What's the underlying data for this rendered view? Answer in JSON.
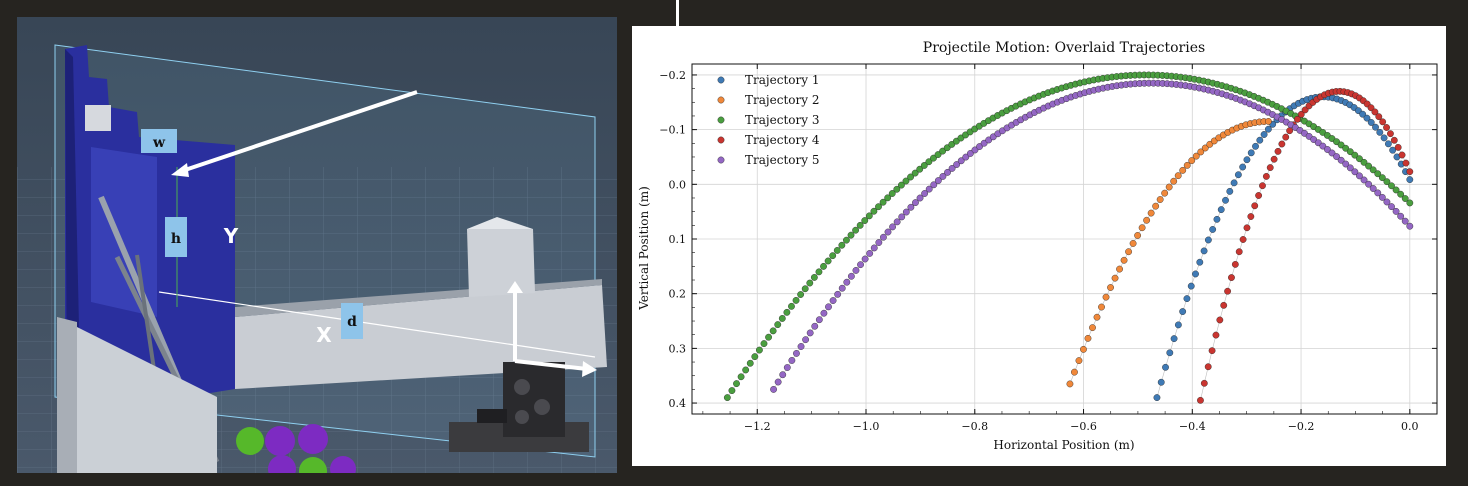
{
  "cad_view": {
    "labels": {
      "w": "w",
      "h": "h",
      "Y": "Y",
      "X": "X",
      "d": "d"
    },
    "colors": {
      "background": "#3e4c5e",
      "backboard": "#2a2f9e",
      "label_box": "#8ec4ea",
      "arrow": "#ffffff",
      "ball_green": "#56b82a",
      "ball_purple": "#7d2bc2"
    }
  },
  "chart_data": {
    "type": "scatter",
    "title": "Projectile Motion: Overlaid Trajectories",
    "xlabel": "Horizontal Position (m)",
    "ylabel": "Vertical Position (m)",
    "xlim": [
      -1.32,
      0.05
    ],
    "ylim": [
      0.42,
      -0.22
    ],
    "y_inverted": true,
    "xticks": [
      -1.2,
      -1.0,
      -0.8,
      -0.6,
      -0.4,
      -0.2,
      0.0
    ],
    "xtick_labels": [
      "−1.2",
      "−1.0",
      "−0.8",
      "−0.6",
      "−0.4",
      "−0.2",
      "0.0"
    ],
    "yticks": [
      -0.2,
      -0.1,
      0.0,
      0.1,
      0.2,
      0.3,
      0.4
    ],
    "ytick_labels": [
      "−0.2",
      "−0.1",
      "0.0",
      "0.1",
      "0.2",
      "0.3",
      "0.4"
    ],
    "grid": true,
    "legend_position": "top-left",
    "series": [
      {
        "name": "Trajectory 1",
        "color": "#3f7ab5",
        "x_start": -0.465,
        "x_end": 0.0,
        "x_peak": -0.16,
        "y_peak": -0.16,
        "y_start": 0.39,
        "y_end": 0.0,
        "n_points": 60
      },
      {
        "name": "Trajectory 2",
        "color": "#f0883a",
        "x_start": -0.625,
        "x_end": -0.26,
        "x_peak": -0.26,
        "y_peak": -0.115,
        "y_start": 0.365,
        "y_end": -0.115,
        "n_points": 45
      },
      {
        "name": "Trajectory 3",
        "color": "#4a9e3f",
        "x_start": -1.255,
        "x_end": 0.0,
        "x_peak": -0.485,
        "y_peak": -0.2,
        "y_start": 0.39,
        "y_end": 0.0,
        "n_points": 150
      },
      {
        "name": "Trajectory 4",
        "color": "#c93530",
        "x_start": -0.385,
        "x_end": 0.0,
        "x_peak": -0.13,
        "y_peak": -0.17,
        "y_start": 0.395,
        "y_end": 0.0,
        "n_points": 55
      },
      {
        "name": "Trajectory 5",
        "color": "#9467c4",
        "x_start": -1.17,
        "x_end": 0.0,
        "x_peak": -0.475,
        "y_peak": -0.185,
        "y_start": 0.375,
        "y_end": 0.0,
        "n_points": 140
      }
    ]
  }
}
